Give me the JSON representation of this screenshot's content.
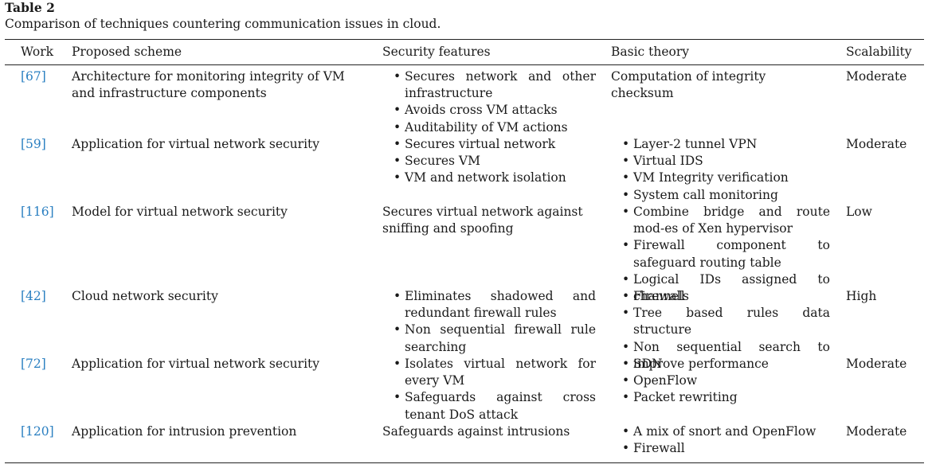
{
  "table": {
    "label": "Table 2",
    "caption": "Comparison of techniques countering communication issues in cloud.",
    "headers": {
      "work": "Work",
      "scheme": "Proposed scheme",
      "security": "Security features",
      "theory": "Basic theory",
      "scalability": "Scalability"
    },
    "rows": [
      {
        "work": "[67]",
        "scheme": "Architecture for monitoring integrity of VM and infrastructure components",
        "security": [
          "Secures network and other infrastructure",
          "Avoids cross VM attacks",
          "Auditability of VM actions"
        ],
        "theory": "Computation of integrity checksum",
        "scalability": "Moderate"
      },
      {
        "work": "[59]",
        "scheme": "Application for virtual network security",
        "security": [
          "Secures virtual network",
          "Secures VM",
          "VM and network isolation"
        ],
        "theory": [
          "Layer-2 tunnel VPN",
          "Virtual IDS",
          "VM Integrity verification",
          "System call monitoring"
        ],
        "scalability": "Moderate"
      },
      {
        "work": "[116]",
        "scheme": "Model for virtual network security",
        "security": "Secures virtual network against sniffing and spoofing",
        "theory": [
          "Combine bridge and route mod-es of Xen hypervisor",
          "Firewall component to safeguard routing table",
          "Logical IDs assigned to channels"
        ],
        "scalability": "Low"
      },
      {
        "work": "[42]",
        "scheme": "Cloud network security",
        "security": [
          "Eliminates shadowed and redundant firewall rules",
          "Non sequential firewall rule searching"
        ],
        "theory": [
          "Firewall",
          "Tree based rules data structure",
          "Non sequential search to improve performance"
        ],
        "scalability": "High"
      },
      {
        "work": "[72]",
        "scheme": "Application for virtual network security",
        "security": [
          "Isolates virtual network for every VM",
          "Safeguards against cross tenant DoS attack"
        ],
        "theory": [
          "SDN",
          "OpenFlow",
          "Packet rewriting"
        ],
        "scalability": "Moderate"
      },
      {
        "work": "[120]",
        "scheme": "Application for intrusion prevention",
        "security": "Safeguards against intrusions",
        "theory": [
          "A mix of snort and OpenFlow",
          "Firewall"
        ],
        "scalability": "Moderate"
      }
    ]
  }
}
